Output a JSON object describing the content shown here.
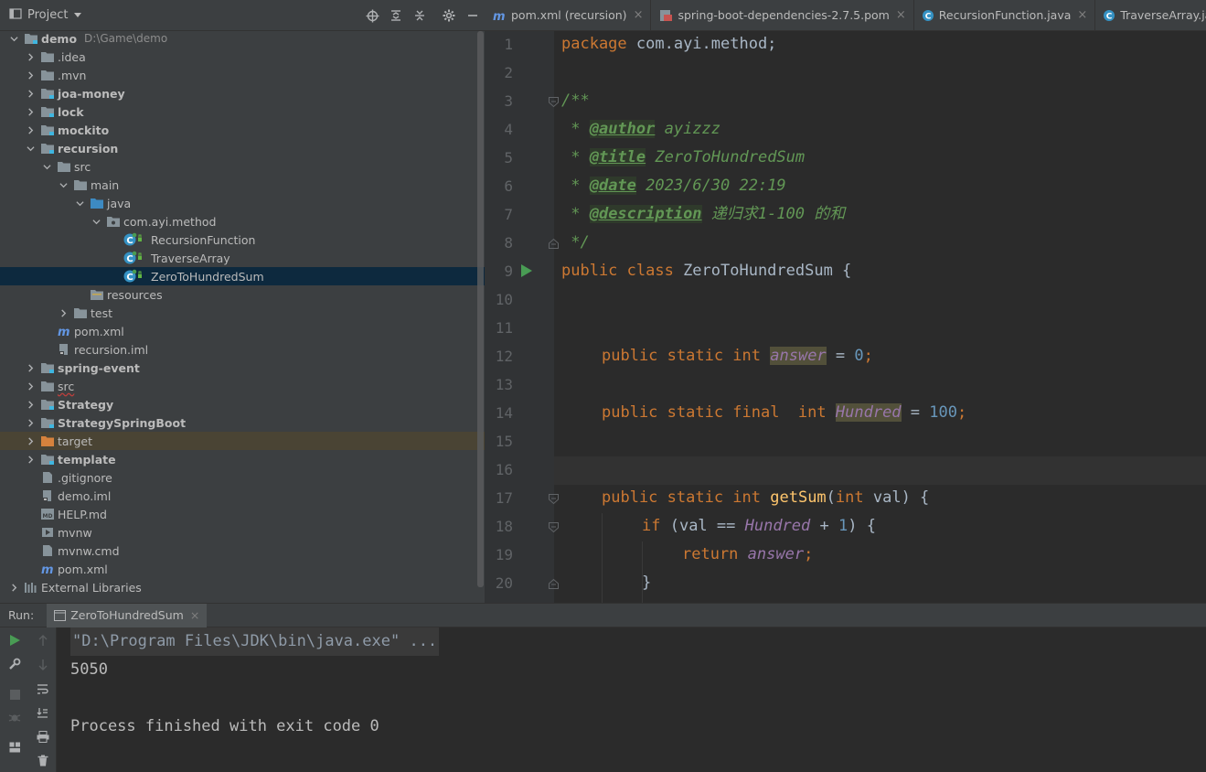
{
  "project_panel": {
    "title": "Project",
    "root_path": "D:\\Game\\demo",
    "tree": [
      {
        "label": "demo",
        "kind": "module-folder",
        "depth": 0,
        "expanded": true,
        "bold": true
      },
      {
        "label": ".idea",
        "kind": "folder",
        "depth": 1,
        "expanded": false
      },
      {
        "label": ".mvn",
        "kind": "folder",
        "depth": 1,
        "expanded": false
      },
      {
        "label": "joa-money",
        "kind": "module-folder",
        "depth": 1,
        "expanded": false,
        "bold": true
      },
      {
        "label": "lock",
        "kind": "module-folder",
        "depth": 1,
        "expanded": false,
        "bold": true
      },
      {
        "label": "mockito",
        "kind": "module-folder",
        "depth": 1,
        "expanded": false,
        "bold": true
      },
      {
        "label": "recursion",
        "kind": "module-folder",
        "depth": 1,
        "expanded": true,
        "bold": true
      },
      {
        "label": "src",
        "kind": "folder",
        "depth": 2,
        "expanded": true
      },
      {
        "label": "main",
        "kind": "folder",
        "depth": 3,
        "expanded": true
      },
      {
        "label": "java",
        "kind": "source-folder",
        "depth": 4,
        "expanded": true
      },
      {
        "label": "com.ayi.method",
        "kind": "package",
        "depth": 5,
        "expanded": true
      },
      {
        "label": "RecursionFunction",
        "kind": "class",
        "depth": 6
      },
      {
        "label": "TraverseArray",
        "kind": "class",
        "depth": 6
      },
      {
        "label": "ZeroToHundredSum",
        "kind": "class",
        "depth": 6,
        "selected": true
      },
      {
        "label": "resources",
        "kind": "resources-folder",
        "depth": 4
      },
      {
        "label": "test",
        "kind": "folder",
        "depth": 3,
        "expanded": false
      },
      {
        "label": "pom.xml",
        "kind": "maven",
        "depth": 2
      },
      {
        "label": "recursion.iml",
        "kind": "iml",
        "depth": 2
      },
      {
        "label": "spring-event",
        "kind": "module-folder",
        "depth": 1,
        "expanded": false,
        "bold": true
      },
      {
        "label": "src",
        "kind": "folder",
        "depth": 1,
        "expanded": false,
        "squiggle": true
      },
      {
        "label": "Strategy",
        "kind": "module-folder",
        "depth": 1,
        "expanded": false,
        "bold": true
      },
      {
        "label": "StrategySpringBoot",
        "kind": "module-folder",
        "depth": 1,
        "expanded": false,
        "bold": true
      },
      {
        "label": "target",
        "kind": "excluded-folder",
        "depth": 1,
        "expanded": false,
        "excluded": true
      },
      {
        "label": "template",
        "kind": "module-folder",
        "depth": 1,
        "expanded": false,
        "bold": true
      },
      {
        "label": ".gitignore",
        "kind": "file",
        "depth": 1
      },
      {
        "label": "demo.iml",
        "kind": "iml",
        "depth": 1
      },
      {
        "label": "HELP.md",
        "kind": "md",
        "depth": 1
      },
      {
        "label": "mvnw",
        "kind": "exec",
        "depth": 1
      },
      {
        "label": "mvnw.cmd",
        "kind": "file",
        "depth": 1
      },
      {
        "label": "pom.xml",
        "kind": "maven",
        "depth": 1
      },
      {
        "label": "External Libraries",
        "kind": "libraries",
        "depth": 0,
        "expanded": false
      }
    ]
  },
  "editor_tabs": [
    {
      "label": "pom.xml (recursion)",
      "icon": "maven"
    },
    {
      "label": "spring-boot-dependencies-2.7.5.pom",
      "icon": "pom"
    },
    {
      "label": "RecursionFunction.java",
      "icon": "class"
    },
    {
      "label": "TraverseArray.java",
      "icon": "class"
    },
    {
      "label": "",
      "icon": "class",
      "active": true
    }
  ],
  "editor": {
    "line_numbers": [
      "1",
      "2",
      "3",
      "4",
      "5",
      "6",
      "7",
      "8",
      "9",
      "10",
      "11",
      "12",
      "13",
      "14",
      "15",
      "16",
      "17",
      "18",
      "19",
      "20"
    ],
    "code": {
      "l1_kw": "package",
      "l1_rest": " com.ayi.method;",
      "l3": "/**",
      "l4_star": " * ",
      "l4_tag": "@author",
      "l4_val": " ayizzz",
      "l5_star": " * ",
      "l5_tag": "@title",
      "l5_val": " ZeroToHundredSum",
      "l6_star": " * ",
      "l6_tag": "@date",
      "l6_val": " 2023/6/30 22:19",
      "l7_star": " * ",
      "l7_tag": "@description",
      "l7_val": " 递归求1-100 的和",
      "l8": " */",
      "l9_kw": "public class",
      "l9_rest": " ZeroToHundredSum {",
      "l12_kw": "public static int",
      "l12_field": "answer",
      "l12_eq": " = ",
      "l12_num": "0",
      "l12_semi": ";",
      "l14_kw": "public static final  int",
      "l14_field": "Hundred",
      "l14_eq": " = ",
      "l14_num": "100",
      "l14_semi": ";",
      "l17_kw": "public static int",
      "l17_fn": "getSum",
      "l17_open": "(",
      "l17_kw2": "int",
      "l17_rest": " val) {",
      "l18_kw": "if",
      "l18_a": " (val == ",
      "l18_field": "Hundred",
      "l18_b": " + ",
      "l18_num": "1",
      "l18_c": ") {",
      "l19_kw": "return",
      "l19_field": "answer",
      "l19_semi": ";",
      "l20": "}"
    }
  },
  "run_panel": {
    "label": "Run:",
    "tab": "ZeroToHundredSum",
    "console": [
      "\"D:\\Program Files\\JDK\\bin\\java.exe\" ...",
      "5050",
      "",
      "Process finished with exit code 0"
    ]
  },
  "colors": {
    "keyword": "#cc7832",
    "doc_comment": "#629755",
    "number": "#6897bb",
    "field": "#9876aa",
    "method": "#ffc66d",
    "selection": "#0d293e"
  }
}
